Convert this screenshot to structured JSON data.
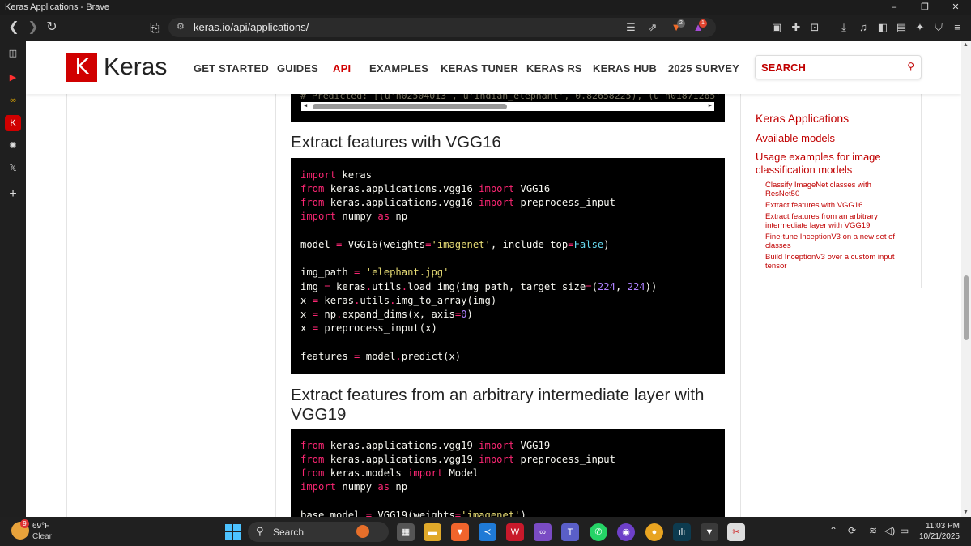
{
  "window": {
    "title": "Keras Applications - Brave",
    "min": "–",
    "max": "❐",
    "close": "✕"
  },
  "toolbar": {
    "url": "keras.io/api/applications/",
    "shield_count": "2",
    "rewards_count": "1"
  },
  "header": {
    "logo_letter": "K",
    "logo_text": "Keras",
    "nav": [
      "GET STARTED",
      "GUIDES",
      "API",
      "EXAMPLES",
      "KERAS TUNER",
      "KERAS RS",
      "KERAS HUB",
      "2025 SURVEY"
    ],
    "search_placeholder": "SEARCH"
  },
  "main": {
    "top_comment": "# Predicted: [(u'n02504013', u'Indian_elephant', 0.82658225), (u'n01871265'",
    "section1_title": "Extract features with VGG16",
    "section2_title_line1": "Extract features from an arbitrary intermediate layer with",
    "section2_title_line2": "VGG19"
  },
  "toc": {
    "top": "Keras Applications",
    "items": [
      "Available models",
      "Usage examples for image",
      "classification models"
    ],
    "sub": [
      "Classify ImageNet classes with",
      "ResNet50",
      "Extract features with VGG16",
      "Extract features from an arbitrary",
      "intermediate layer with VGG19",
      "Fine-tune InceptionV3 on a new set of",
      "classes",
      "Build InceptionV3 over a custom input",
      "tensor"
    ]
  },
  "taskbar": {
    "weather_temp": "69°F",
    "weather_cond": "Clear",
    "weather_badge": "9",
    "search_label": "Search",
    "time": "11:03 PM",
    "date": "10/21/2025"
  }
}
